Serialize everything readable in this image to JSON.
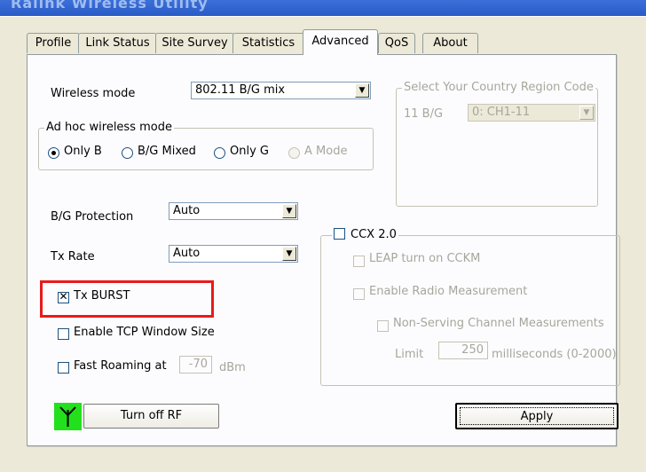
{
  "window": {
    "title": "Ralink Wireless Utility"
  },
  "tabs": [
    {
      "label": "Profile"
    },
    {
      "label": "Link Status"
    },
    {
      "label": "Site Survey"
    },
    {
      "label": "Statistics"
    },
    {
      "label": "Advanced"
    },
    {
      "label": "QoS"
    },
    {
      "label": "About"
    }
  ],
  "active_tab": "Advanced",
  "wireless_mode": {
    "label": "Wireless mode",
    "value": "802.11 B/G mix"
  },
  "adhoc": {
    "legend": "Ad hoc wireless mode",
    "options": [
      "Only B",
      "B/G Mixed",
      "Only G",
      "A Mode"
    ],
    "selected": "Only B"
  },
  "country": {
    "legend": "Select Your Country Region Code",
    "band_label": "11 B/G",
    "value": "0: CH1-11"
  },
  "bg_protection": {
    "label": "B/G Protection",
    "value": "Auto"
  },
  "tx_rate": {
    "label": "Tx Rate",
    "value": "Auto"
  },
  "tx_burst": {
    "label": "Tx BURST",
    "checked": true
  },
  "tcp_window": {
    "label": "Enable TCP Window Size",
    "checked": false
  },
  "fast_roaming": {
    "label": "Fast Roaming at",
    "value": "-70",
    "unit": "dBm",
    "checked": false
  },
  "ccx": {
    "label": "CCX 2.0",
    "checked": false,
    "leap_label": "LEAP turn on CCKM",
    "radio_meas_label": "Enable Radio Measurement",
    "non_serving_label": "Non-Serving Channel Measurements",
    "limit_label": "Limit",
    "limit_value": "250",
    "limit_unit": "milliseconds (0-2000)"
  },
  "buttons": {
    "turn_off_rf": "Turn off RF",
    "apply": "Apply"
  },
  "colors": {
    "highlight": "#e81b1b",
    "rf_icon_bg": "#22e01c",
    "title_bar": "#2a5bc8"
  }
}
